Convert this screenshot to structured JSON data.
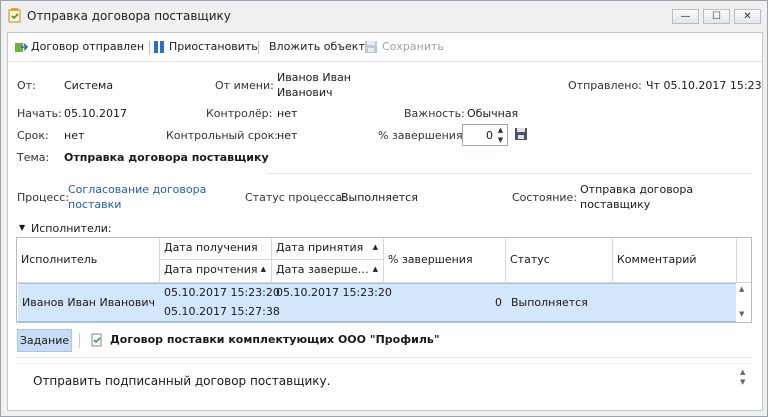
{
  "window": {
    "title": "Отправка договора поставщику"
  },
  "window_buttons": {
    "minimize": "—",
    "maximize": "☐",
    "close": "✕"
  },
  "toolbar": {
    "sent": "Договор отправлен",
    "pause": "Приостановить",
    "attach": "Вложить объект",
    "save": "Сохранить"
  },
  "fields": {
    "from_label": "От:",
    "from_value": "Система",
    "on_behalf_label": "От имени:",
    "on_behalf_value_line1": "Иванов Иван",
    "on_behalf_value_line2": "Иванович",
    "sent_label": "Отправлено:",
    "sent_value": "Чт 05.10.2017 15:23",
    "start_label": "Начать:",
    "start_value": "05.10.2017",
    "controller_label": "Контролёр:",
    "controller_value": "нет",
    "priority_label": "Важность:",
    "priority_value": "Обычная",
    "due_label": "Срок:",
    "due_value": "нет",
    "control_due_label": "Контрольный срок:",
    "control_due_value": "нет",
    "completion_label": "% завершения:",
    "completion_value": "0",
    "subject_label": "Тема:",
    "subject_value": "Отправка договора поставщику"
  },
  "process": {
    "process_label": "Процесс:",
    "process_value_line1": "Согласование договора",
    "process_value_line2": "поставки",
    "status_label": "Статус процесса:",
    "status_value": "Выполняется",
    "state_label": "Состояние:",
    "state_value_line1": "Отправка договора",
    "state_value_line2": "поставщику"
  },
  "performers": {
    "section_label": "Исполнители:",
    "headers": {
      "performer": "Исполнитель",
      "received": "Дата получения",
      "read": "Дата прочтения",
      "accepted": "Дата принятия",
      "finished": "Дата заверше…",
      "percent": "% завершения",
      "status": "Статус",
      "comment": "Комментарий"
    },
    "rows": [
      {
        "performer": "Иванов Иван Иванович",
        "received": "05.10.2017 15:23:20",
        "read": "05.10.2017 15:27:38",
        "accepted": "05.10.2017 15:23:20",
        "finished": "",
        "percent": "0",
        "status": "Выполняется",
        "comment": ""
      }
    ]
  },
  "tabs": {
    "task": "Задание",
    "document": "Договор поставки комплектующих ООО \"Профиль\""
  },
  "task_text": "Отправить подписанный договор поставщику.",
  "icons": [
    "app-icon",
    "sent-icon",
    "pause-icon",
    "save-icon",
    "disk-icon",
    "document-icon",
    "triangle-down-icon",
    "sort-up-icon",
    "scroll-up-icon",
    "scroll-down-icon"
  ],
  "colors": {
    "selection": "#d4e6fa",
    "link": "#1f5fb0",
    "tab": "#c8dcf3"
  }
}
